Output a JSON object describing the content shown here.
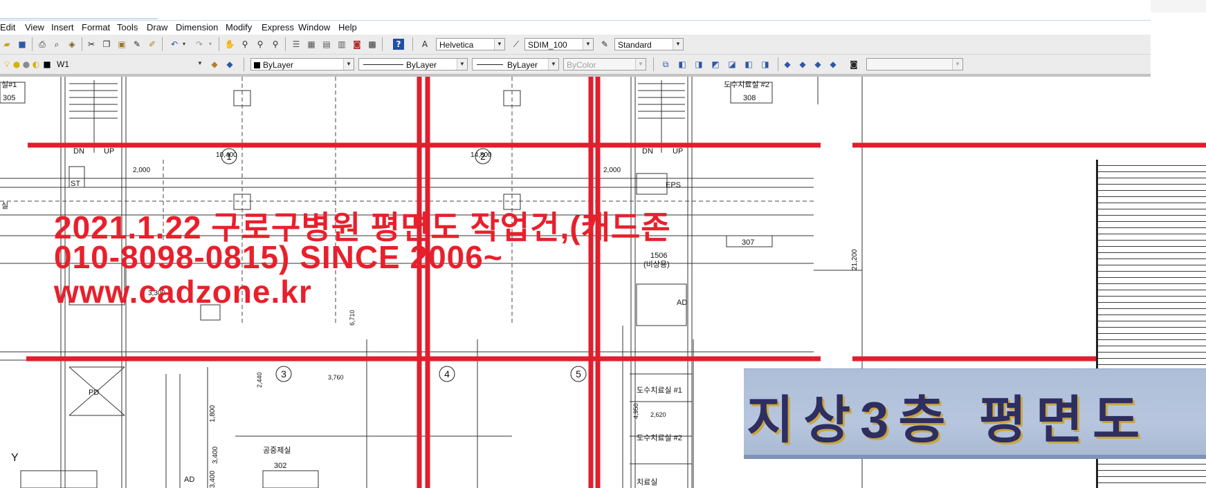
{
  "menu": [
    "Edit",
    "View",
    "Insert",
    "Format",
    "Tools",
    "Draw",
    "Dimension",
    "Modify",
    "Express",
    "Window",
    "Help"
  ],
  "toolbar1": {
    "text_style_value": "Helvetica",
    "dim_style_value": "SDIM_100",
    "table_style_value": "Standard"
  },
  "toolbar2": {
    "layer_value": "W1",
    "color_value": "ByLayer",
    "linetype_value": "ByLayer",
    "lineweight_value": "ByLayer",
    "plotstyle_value": "ByColor",
    "view_value": ""
  },
  "icons": {
    "toolbar1": [
      "open-icon",
      "save-icon",
      "print-icon",
      "plot-preview-icon",
      "publish-icon",
      "cut-icon",
      "copy-icon",
      "paste-icon",
      "match-properties-icon",
      "block-editor-icon",
      "undo-icon",
      "redo-icon",
      "pan-icon",
      "zoom-realtime-icon",
      "zoom-window-icon",
      "zoom-previous-icon",
      "properties-icon",
      "design-center-icon",
      "tool-palettes-icon",
      "sheet-set-icon",
      "markup-icon",
      "calculator-icon",
      "help-icon",
      "text-style-icon",
      "dim-style-icon",
      "table-style-icon"
    ],
    "toolbar2": [
      "layer-on-icon",
      "layer-freeze-icon",
      "layer-lock-icon",
      "layer-color-icon",
      "layer-previous-icon",
      "layer-states-icon",
      "named-views-icon",
      "top-view-icon",
      "bottom-view-icon",
      "left-view-icon",
      "right-view-icon",
      "front-view-icon",
      "back-view-icon",
      "sw-iso-icon",
      "se-iso-icon",
      "ne-iso-icon",
      "nw-iso-icon",
      "camera-icon"
    ]
  },
  "colors": {
    "red_line": "#e01f2d",
    "overlay_text": "#e8202c",
    "title_block_bg": "#b0c0da"
  },
  "drawing": {
    "room_labels": [
      "실#1",
      "305",
      "도수치료실 #2",
      "308",
      "EPS",
      "1506",
      "307",
      "공중제실",
      "302",
      "도수치료실 #1",
      "도수치료실 #2",
      "치료실",
      "PD",
      "AD",
      "AD",
      "ST",
      "DN",
      "UP",
      "DN",
      "UP",
      "(비상용)",
      "실"
    ],
    "grid_bubbles": [
      "1",
      "2",
      "3",
      "4",
      "5",
      "2"
    ],
    "dimensions": [
      "10,400",
      "14,800",
      "2,000",
      "2,000",
      "21,200",
      "3,400",
      "2,440",
      "3,760",
      "1,800",
      "3,400",
      "3,300",
      "6,710",
      "2,620",
      "4,950"
    ],
    "ucs_label": "Y"
  },
  "overlay": {
    "line1": "2021.1.22 구로구병원 평면도 작업건,(캐드존",
    "line2": "010-8098-0815) SINCE 2006~",
    "line3": "www.cadzone.kr"
  },
  "title_block": {
    "text": "지상3층 평면도"
  }
}
